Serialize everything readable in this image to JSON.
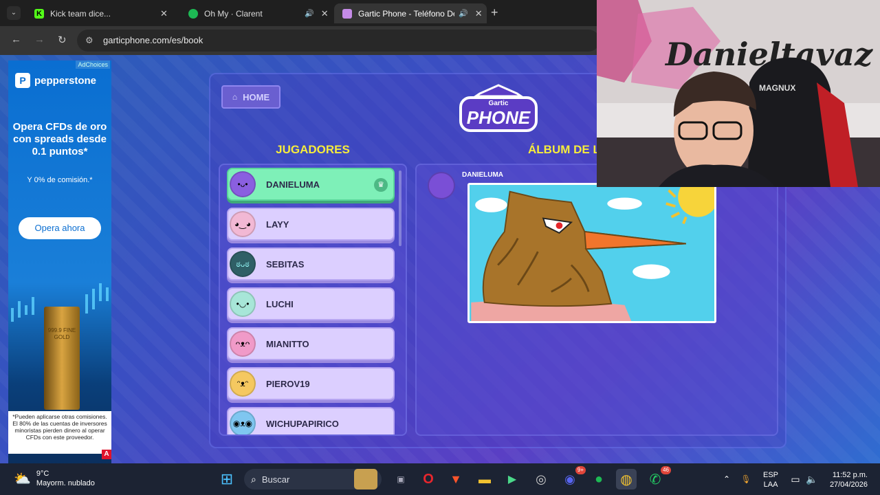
{
  "browser": {
    "tabs": [
      {
        "title": "Kick team dice...",
        "color": "#53fc18",
        "letter": "K"
      },
      {
        "title": "Oh My · Clarent",
        "color": "#1db954",
        "letter": "♫"
      },
      {
        "title": "Gartic Phone - Teléfono Des",
        "color": "#c58be8",
        "letter": "☎"
      }
    ],
    "url": "garticphone.com/es/book"
  },
  "ad": {
    "adchoices": "AdChoices",
    "brand": "pepperstone",
    "headline": "Opera CFDs de oro con spreads desde 0.1 puntos*",
    "sub": "Y 0% de comisión.*",
    "cta": "Opera ahora",
    "bar_text": "999.9 FINE GOLD",
    "disclaimer": "*Pueden aplicarse otras comisiones. El 80% de las cuentas de inversores minoristas pierden dinero al operar CFDs con este proveedor."
  },
  "game": {
    "home_label": "HOME",
    "logo_top": "Gartic",
    "logo_main": "PHONE",
    "players_title": "JUGADORES",
    "album_title": "ÁLBUM DE L",
    "players": [
      {
        "name": "DANIELUMA",
        "host": true,
        "avatar_color": "#8a5fe0",
        "face": "•ᴗ•"
      },
      {
        "name": "LAYY",
        "host": false,
        "avatar_color": "#f2b8d4",
        "face": "◕‿◕"
      },
      {
        "name": "SEBITAS",
        "host": false,
        "avatar_color": "#2f5f66",
        "face": "ಠᴗಠ"
      },
      {
        "name": "LUCHI",
        "host": false,
        "avatar_color": "#a7e6d8",
        "face": "•◡•"
      },
      {
        "name": "MIANITTO",
        "host": false,
        "avatar_color": "#f09ac8",
        "face": "ᴖᴥᴖ"
      },
      {
        "name": "PIEROV19",
        "host": false,
        "avatar_color": "#f5c860",
        "face": "ᵔᴥᵔ"
      },
      {
        "name": "WICHUPAPIRICO",
        "host": false,
        "avatar_color": "#7fc6f0",
        "face": "◉ᴥ◉"
      }
    ],
    "album_author": "DANIELUMA"
  },
  "webcam": {
    "wall_text": "Danieltavaz",
    "chair_text": "MAGNUX"
  },
  "taskbar": {
    "weather_temp": "9°C",
    "weather_desc": "Mayorm. nublado",
    "search_placeholder": "Buscar",
    "discord_badge": "9+",
    "whatsapp_badge": "46",
    "lang_top": "ESP",
    "lang_bottom": "LAA",
    "time": "11:52 p.m.",
    "date": "27/04/2026"
  }
}
